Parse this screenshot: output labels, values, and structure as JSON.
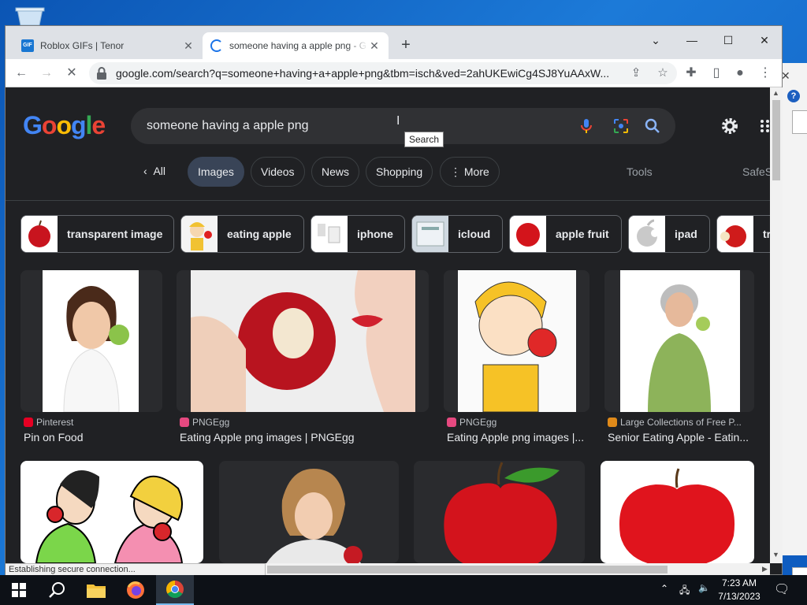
{
  "browser": {
    "tabs": [
      {
        "title": "Roblox GIFs | Tenor",
        "favicon": "GIF"
      },
      {
        "title": "someone having a apple png - G"
      }
    ],
    "url": "google.com/search?q=someone+having+a+apple+png&tbm=isch&ved=2ahUKEwiCg4SJ8YuAAxW...",
    "status": "Establishing secure connection..."
  },
  "google": {
    "logo": "Google",
    "query": "someone having a apple png",
    "tooltip": "Search",
    "filters": [
      "All",
      "Images",
      "Videos",
      "News",
      "Shopping",
      "More"
    ],
    "tools": "Tools",
    "safesearch": "SafeS",
    "related": [
      {
        "label": "transparent image"
      },
      {
        "label": "eating apple"
      },
      {
        "label": "iphone"
      },
      {
        "label": "icloud"
      },
      {
        "label": "apple fruit"
      },
      {
        "label": "ipad"
      },
      {
        "label": "tr"
      }
    ],
    "results": [
      {
        "source": "Pinterest",
        "title": "Pin on Food"
      },
      {
        "source": "PNGEgg",
        "title": "Eating Apple png images | PNGEgg"
      },
      {
        "source": "PNGEgg",
        "title": "Eating Apple png images |..."
      },
      {
        "source": "Large Collections of Free P...",
        "title": "Senior Eating Apple - Eatin..."
      },
      {
        "source": "",
        "title": ""
      },
      {
        "source": "",
        "title": ""
      },
      {
        "source": "",
        "title": ""
      },
      {
        "source": "",
        "title": ""
      }
    ]
  },
  "taskbar": {
    "time": "7:23 AM",
    "date": "7/13/2023",
    "apps": [
      "start-icon",
      "search-icon",
      "file-explorer-icon",
      "firefox-icon",
      "chrome-icon"
    ]
  },
  "colors": {
    "page_bg": "#202124",
    "chip_active": "#394457",
    "desktop": "#1c7ad8"
  }
}
